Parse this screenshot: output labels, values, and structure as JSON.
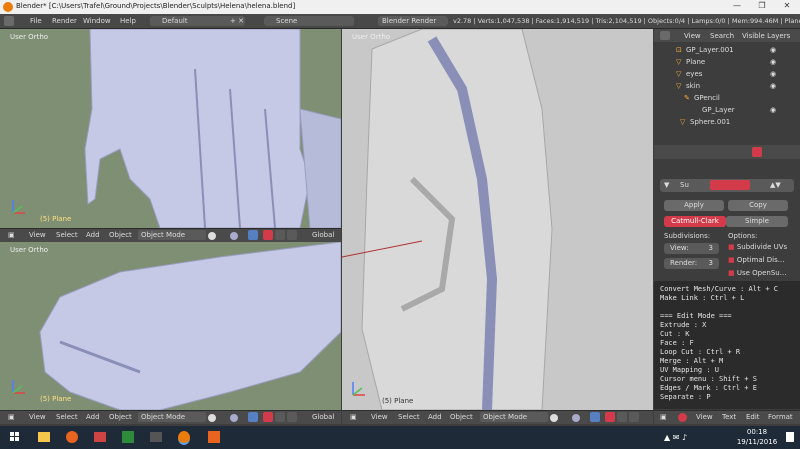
{
  "window": {
    "title": "Blender* [C:\\Users\\Trafel\\Ground\\Projects\\Blender\\Sculpts\\Helena\\helena.blend]",
    "minimize": "—",
    "maximize": "❐",
    "close": "✕"
  },
  "info_header": {
    "menus": [
      "File",
      "Render",
      "Window",
      "Help"
    ],
    "screen_layout": "Default",
    "scene": "Scene",
    "engine": "Blender Render",
    "stats": "v2.78 | Verts:1,047,538 | Faces:1,914,519 | Tris:2,104,519 | Objects:0/4 | Lamps:0/0 | Mem:994.46M | Plane"
  },
  "viewports": {
    "top_left": {
      "label": "User Ortho",
      "object": "(5) Plane"
    },
    "bottom_left": {
      "label": "User Ortho",
      "object": "(5) Plane"
    },
    "right": {
      "label": "User Ortho",
      "object": "(5) Plane"
    }
  },
  "view3d_header": {
    "menus": [
      "View",
      "Select",
      "Add",
      "Object"
    ],
    "mode": "Object Mode",
    "orientation": "Global"
  },
  "outliner": {
    "tabs": [
      "View",
      "Search",
      "Visible Layers"
    ],
    "rows": [
      {
        "name": "GP_Layer.001",
        "indent": 0
      },
      {
        "name": "Plane",
        "indent": 0
      },
      {
        "name": "eyes",
        "indent": 0
      },
      {
        "name": "skin",
        "indent": 0
      },
      {
        "name": "GPencil",
        "indent": 1
      },
      {
        "name": "GP_Layer",
        "indent": 2
      },
      {
        "name": "Sphere.001",
        "indent": 1
      }
    ]
  },
  "properties": {
    "modifier_name": "Su",
    "apply": "Apply",
    "copy": "Copy",
    "catmull": "Catmull-Clark",
    "simple": "Simple",
    "subdivisions_label": "Subdivisions:",
    "options_label": "Options:",
    "view_label": "View:",
    "view_value": "3",
    "render_label": "Render:",
    "render_value": "3",
    "opt1": "Subdivide UVs",
    "opt2": "Optimal Dis...",
    "opt3": "Use OpenSu..."
  },
  "text_editor": {
    "lines": [
      "Convert Mesh/Curve : Alt + C",
      "Make Link : Ctrl + L",
      "",
      "=== Edit Mode ===",
      "Extrude : X",
      "Cut : K",
      "Face : F",
      "Loop Cut : Ctrl + R",
      "Merge : Alt + M",
      "UV Mapping : U",
      "Cursor menu : Shift + S",
      "Edges / Mark : Ctrl + E",
      "Separate : P"
    ],
    "menus": [
      "View",
      "Text",
      "Edit",
      "Format"
    ]
  },
  "taskbar": {
    "time": "00:18",
    "date": "19/11/2016"
  },
  "colors": {
    "viewport_bg": "#7f8f74",
    "mesh": "#c6c9e6",
    "accent_red": "#d33a4a",
    "taskbar": "#1e2a38"
  }
}
